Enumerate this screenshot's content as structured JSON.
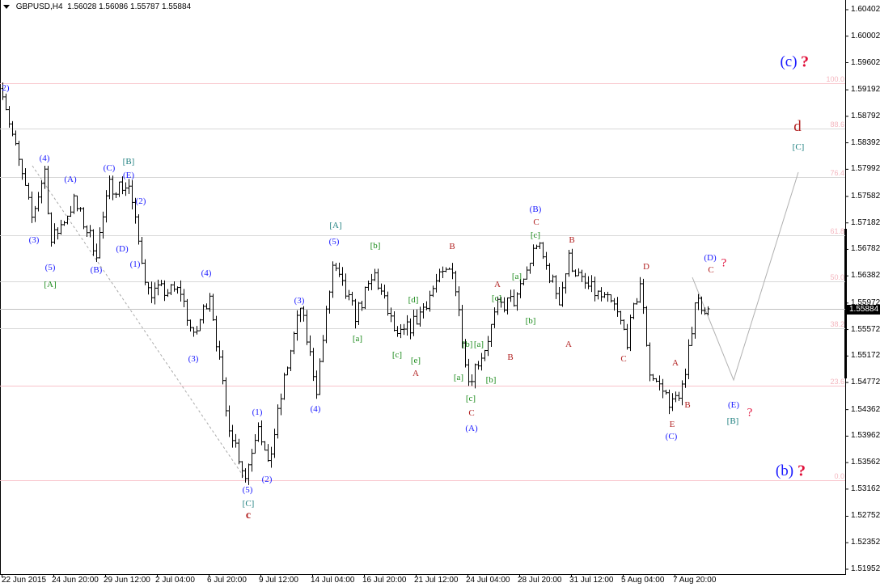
{
  "header": {
    "symbol": "GBPUSD,H4",
    "open": "1.56028",
    "high": "1.56086",
    "low": "1.55787",
    "close": "1.55884"
  },
  "current_price": "1.55884",
  "colors": {
    "bars": "#000000",
    "fib": "#f4b8c0",
    "wave_blue": "#1a1aff",
    "wave_green": "#1a8a1a",
    "wave_brown": "#b22222",
    "wave_teal": "#208080",
    "question": "#e0103a",
    "projection": "#b0b0b0"
  },
  "fib_levels": [
    {
      "label": "100.0",
      "price": 1.5929
    },
    {
      "label": "88.6",
      "price": 1.5861
    },
    {
      "label": "76.4",
      "price": 1.5788
    },
    {
      "label": "61.8",
      "price": 1.57
    },
    {
      "label": "50.0",
      "price": 1.563
    },
    {
      "label": "38.2",
      "price": 1.5559
    },
    {
      "label": "23.6",
      "price": 1.5472
    },
    {
      "label": "0.0",
      "price": 1.533
    }
  ],
  "labels": [
    {
      "text": "2)",
      "c": "blue"
    },
    {
      "text": "(4)",
      "c": "blue"
    },
    {
      "text": "(3)",
      "c": "blue"
    },
    {
      "text": "(5)",
      "c": "blue"
    },
    {
      "text": "[A]",
      "c": "green"
    },
    {
      "text": "(A)",
      "c": "blue"
    },
    {
      "text": "(B)",
      "c": "blue"
    },
    {
      "text": "(C)",
      "c": "blue"
    },
    {
      "text": "[B]",
      "c": "teal"
    },
    {
      "text": "(E)",
      "c": "blue"
    },
    {
      "text": "(2)",
      "c": "blue"
    },
    {
      "text": "(D)",
      "c": "blue"
    },
    {
      "text": "(1)",
      "c": "blue"
    },
    {
      "text": "(4)",
      "c": "blue"
    },
    {
      "text": "(3)",
      "c": "blue"
    },
    {
      "text": "(1)",
      "c": "blue"
    },
    {
      "text": "(5)",
      "c": "blue"
    },
    {
      "text": "(2)",
      "c": "blue"
    },
    {
      "text": "[C]",
      "c": "teal"
    },
    {
      "text": "c",
      "c": "brown"
    },
    {
      "text": "(3)",
      "c": "blue"
    },
    {
      "text": "(4)",
      "c": "blue"
    },
    {
      "text": "[A]",
      "c": "teal"
    },
    {
      "text": "(5)",
      "c": "blue"
    },
    {
      "text": "[b]",
      "c": "green"
    },
    {
      "text": "[a]",
      "c": "green"
    },
    {
      "text": "[c]",
      "c": "green"
    },
    {
      "text": "[d]",
      "c": "green"
    },
    {
      "text": "[e]",
      "c": "green"
    },
    {
      "text": "A",
      "c": "brown"
    },
    {
      "text": "B",
      "c": "brown"
    },
    {
      "text": "[b]",
      "c": "green"
    },
    {
      "text": "[a]",
      "c": "green"
    },
    {
      "text": "[a]",
      "c": "green"
    },
    {
      "text": "[c]",
      "c": "green"
    },
    {
      "text": "C",
      "c": "brown"
    },
    {
      "text": "(A)",
      "c": "blue"
    },
    {
      "text": "[b]",
      "c": "green"
    },
    {
      "text": "A",
      "c": "brown"
    },
    {
      "text": "[c]",
      "c": "green"
    },
    {
      "text": "[a]",
      "c": "green"
    },
    {
      "text": "[b]",
      "c": "green"
    },
    {
      "text": "B",
      "c": "brown"
    },
    {
      "text": "(B)",
      "c": "blue"
    },
    {
      "text": "C",
      "c": "brown"
    },
    {
      "text": "[c]",
      "c": "green"
    },
    {
      "text": "B",
      "c": "brown"
    },
    {
      "text": "A",
      "c": "brown"
    },
    {
      "text": "D",
      "c": "brown"
    },
    {
      "text": "C",
      "c": "brown"
    },
    {
      "text": "A",
      "c": "brown"
    },
    {
      "text": "B",
      "c": "brown"
    },
    {
      "text": "E",
      "c": "brown"
    },
    {
      "text": "(C)",
      "c": "blue"
    },
    {
      "text": "(D)",
      "c": "blue"
    },
    {
      "text": "C",
      "c": "brown"
    },
    {
      "text": "?",
      "c": "question"
    },
    {
      "text": "(E)",
      "c": "blue"
    },
    {
      "text": "[B]",
      "c": "teal"
    },
    {
      "text": "?",
      "c": "question"
    },
    {
      "text": "(c)",
      "c": "blue"
    },
    {
      "text": "?",
      "c": "question"
    },
    {
      "text": "d",
      "c": "brown"
    },
    {
      "text": "[C]",
      "c": "teal"
    },
    {
      "text": "(b)",
      "c": "blue"
    },
    {
      "text": "?",
      "c": "question"
    }
  ],
  "chart_data": {
    "type": "ohlc",
    "title": "GBPUSD,H4",
    "ylim": [
      1.51952,
      1.60402
    ],
    "y_ticks": [
      "1.60402",
      "1.60002",
      "1.59602",
      "1.59192",
      "1.58792",
      "1.58392",
      "1.57992",
      "1.57582",
      "1.57182",
      "1.56782",
      "1.56382",
      "1.55972",
      "1.55572",
      "1.55172",
      "1.54772",
      "1.54362",
      "1.53962",
      "1.53562",
      "1.53162",
      "1.52752",
      "1.52352",
      "1.51952"
    ],
    "x_ticks": [
      "22 Jun 2015",
      "24 Jun 20:00",
      "29 Jun 12:00",
      "2 Jul 04:00",
      "6 Jul 20:00",
      "9 Jul 12:00",
      "14 Jul 04:00",
      "16 Jul 20:00",
      "21 Jul 12:00",
      "24 Jul 04:00",
      "28 Jul 20:00",
      "31 Jul 12:00",
      "5 Aug 04:00",
      "7 Aug 20:00"
    ],
    "price_path_by_bar": [
      [
        0,
        1.5921
      ],
      [
        2,
        1.5872
      ],
      [
        9,
        1.5725
      ],
      [
        13,
        1.5798
      ],
      [
        15,
        1.5689
      ],
      [
        22,
        1.575
      ],
      [
        29,
        1.5676
      ],
      [
        33,
        1.5774
      ],
      [
        39,
        1.5774
      ],
      [
        42,
        1.5689
      ],
      [
        45,
        1.5615
      ],
      [
        55,
        1.5615
      ],
      [
        59,
        1.5542
      ],
      [
        64,
        1.5615
      ],
      [
        69,
        1.5432
      ],
      [
        75,
        1.5334
      ],
      [
        79,
        1.542
      ],
      [
        82,
        1.5347
      ],
      [
        87,
        1.5481
      ],
      [
        92,
        1.5591
      ],
      [
        97,
        1.5469
      ],
      [
        102,
        1.5652
      ],
      [
        109,
        1.5579
      ],
      [
        115,
        1.564
      ],
      [
        122,
        1.5542
      ],
      [
        128,
        1.5573
      ],
      [
        134,
        1.5628
      ],
      [
        139,
        1.5652
      ],
      [
        144,
        1.5481
      ],
      [
        149,
        1.553
      ],
      [
        153,
        1.5591
      ],
      [
        159,
        1.5603
      ],
      [
        165,
        1.5689
      ],
      [
        172,
        1.5603
      ],
      [
        175,
        1.5664
      ],
      [
        179,
        1.5628
      ],
      [
        189,
        1.5591
      ],
      [
        193,
        1.5542
      ],
      [
        197,
        1.5628
      ],
      [
        200,
        1.5493
      ],
      [
        207,
        1.5444
      ],
      [
        211,
        1.5481
      ],
      [
        214,
        1.5603
      ],
      [
        218,
        1.5588
      ]
    ],
    "projection": [
      {
        "label": "(E)",
        "price": 1.5477
      },
      {
        "label": "[C] d",
        "price": 1.58
      }
    ]
  }
}
